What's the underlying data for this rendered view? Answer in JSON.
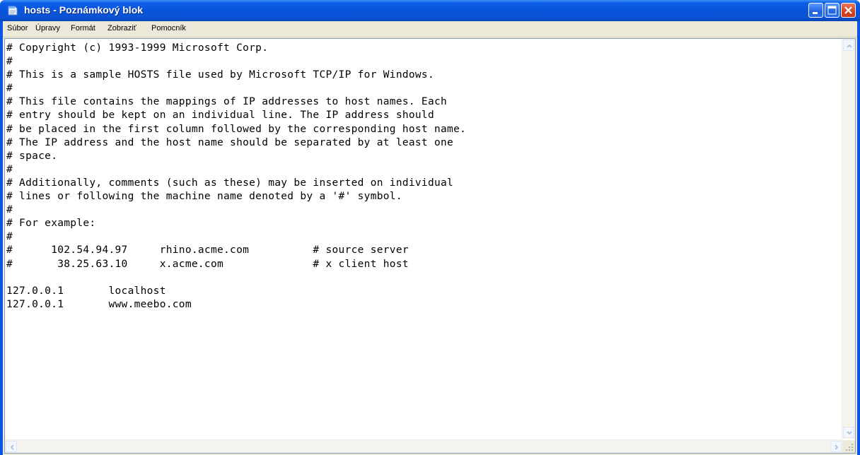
{
  "window": {
    "title": "hosts - Poznámkový blok",
    "colors": {
      "titlebar": "#0a54e6",
      "close_button": "#d3441e",
      "menubar": "#ece9d8",
      "editor_background": "#ffffff",
      "text": "#000000"
    }
  },
  "menu": {
    "items": [
      "Súbor",
      "Úpravy",
      "Formát",
      "Zobraziť",
      "Pomocník"
    ]
  },
  "editor": {
    "lines": [
      "# Copyright (c) 1993-1999 Microsoft Corp.",
      "#",
      "# This is a sample HOSTS file used by Microsoft TCP/IP for Windows.",
      "#",
      "# This file contains the mappings of IP addresses to host names. Each",
      "# entry should be kept on an individual line. The IP address should",
      "# be placed in the first column followed by the corresponding host name.",
      "# The IP address and the host name should be separated by at least one",
      "# space.",
      "#",
      "# Additionally, comments (such as these) may be inserted on individual",
      "# lines or following the machine name denoted by a '#' symbol.",
      "#",
      "# For example:",
      "#",
      "#      102.54.94.97     rhino.acme.com          # source server",
      "#       38.25.63.10     x.acme.com              # x client host",
      "",
      "127.0.0.1       localhost",
      "127.0.0.1       www.meebo.com"
    ]
  },
  "icons": [
    "notepad-app-icon",
    "minimize-icon",
    "maximize-icon",
    "close-icon",
    "scroll-up-icon",
    "scroll-down-icon",
    "scroll-left-icon",
    "scroll-right-icon",
    "resize-grip-icon"
  ]
}
